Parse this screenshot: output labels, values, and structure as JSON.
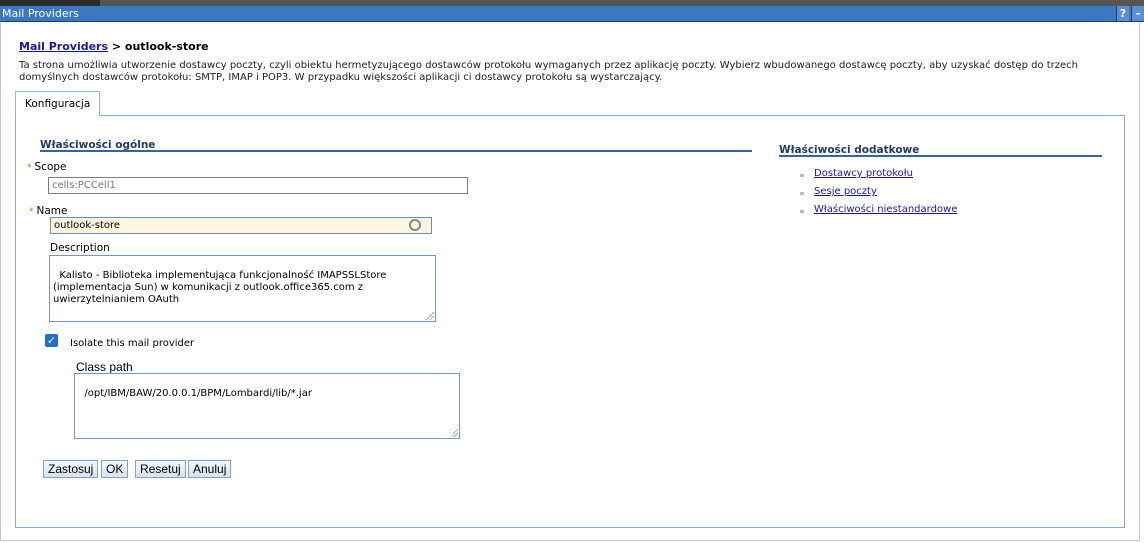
{
  "window": {
    "title": "Mail Providers",
    "help_label": "?",
    "minimize_label": "–"
  },
  "breadcrumb": {
    "parent_link": "Mail Providers",
    "separator": " > ",
    "current": "outlook-store"
  },
  "intro_text": "Ta strona umożliwia utworzenie dostawcy poczty, czyli obiektu hermetyzującego dostawców protokołu wymaganych przez aplikację poczty. Wybierz wbudowanego dostawcę poczty, aby uzyskać dostęp do trzech domyślnych dostawców protokołu: SMTP, IMAP i POP3. W przypadku większości aplikacji ci dostawcy protokołu są wystarczający.",
  "tabs": [
    {
      "label": "Konfiguracja",
      "active": true
    }
  ],
  "general": {
    "title": "Właściwości ogólne",
    "required_marker": "*",
    "scope": {
      "label": "Scope",
      "value": "cells:PCCell1"
    },
    "name": {
      "label": "Name",
      "value": "outlook-store"
    },
    "description": {
      "label": "Description",
      "value": "Kalisto - Biblioteka implementująca funkcjonalność IMAPSSLStore (implementacja Sun) w komunikacji z outlook.office365.com z uwierzytelnianiem OAuth"
    },
    "isolate": {
      "label": "Isolate this mail provider",
      "checked": true,
      "check_glyph": "✓"
    },
    "class_path": {
      "label": "Class path",
      "value": "/opt/IBM/BAW/20.0.0.1/BPM/Lombardi/lib/*.jar"
    }
  },
  "buttons": {
    "apply": "Zastosuj",
    "ok": "OK",
    "reset": "Resetuj",
    "cancel": "Anuluj"
  },
  "additional": {
    "title": "Właściwości dodatkowe",
    "links": [
      "Dostawcy protokołu",
      "Sesje poczty",
      "Właściwości niestandardowe"
    ]
  }
}
